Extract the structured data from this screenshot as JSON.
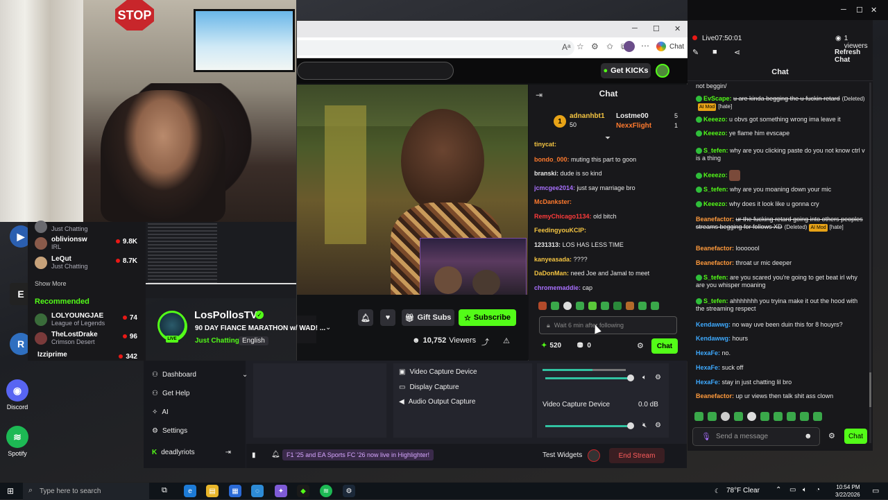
{
  "webcam": {
    "stop_sign": "STOP"
  },
  "desktop_icons": [
    {
      "label": "Discord"
    },
    {
      "label": "Spotify"
    }
  ],
  "browser": {
    "window_controls": [
      "─",
      "☐",
      "✕"
    ],
    "toolbar_chat_label": "Chat",
    "get_kicks_label": "Get KICKs",
    "chat_header": "Chat",
    "leaderboard": {
      "rank": "1",
      "first_name": "adnanhbt1",
      "first_value": "50",
      "entries": [
        {
          "name": "Lostme00",
          "value": "5"
        },
        {
          "name": "NexxFlight",
          "value": "1"
        }
      ]
    },
    "messages": [
      {
        "user": "tinycat:",
        "text": "",
        "color": "#f5c542"
      },
      {
        "user": "bondo_000:",
        "text": "muting this part to goon",
        "color": "#ff7a2e"
      },
      {
        "user": "branski:",
        "text": "dude is so kind",
        "color": "#e8e8e8"
      },
      {
        "user": "jcmcgee2014:",
        "text": "just say marriage bro",
        "color": "#a970ff"
      },
      {
        "user": "McDankster:",
        "text": "",
        "color": "#ff7a2e"
      },
      {
        "user": "RemyChicago1134:",
        "text": "old bitch",
        "color": "#ff3b3b"
      },
      {
        "user": "FeedingyouKCIP:",
        "text": "",
        "color": "#f5c542"
      },
      {
        "user": "1231313:",
        "text": "LOS HAS LESS TIME",
        "color": "#e8e8e8"
      },
      {
        "user": "kanyeasada:",
        "text": "????",
        "color": "#f5c542"
      },
      {
        "user": "DaDonMan:",
        "text": "need Joe and Jamal to meet",
        "color": "#f5c542"
      },
      {
        "user": "chromemaddie:",
        "text": "cap",
        "color": "#a970ff"
      }
    ],
    "chat_input_placeholder": "Wait 6 min after following",
    "points": "520",
    "points2": "0",
    "chat_button": "Chat",
    "sidebar": [
      {
        "name": "",
        "sub": "Just Chatting",
        "count": ""
      },
      {
        "name": "oblivionsw",
        "sub": "IRL",
        "count": "9.8K"
      },
      {
        "name": "LeQut",
        "sub": "Just Chatting",
        "count": "8.7K"
      }
    ],
    "show_more": "Show More",
    "recommended_label": "Recommended",
    "recommended": [
      {
        "name": "LOLYOUNGJAE",
        "sub": "League of Legends",
        "count": "74"
      },
      {
        "name": "TheLostDrake",
        "sub": "Crimson Desert",
        "count": "96"
      },
      {
        "name": "Izziprime",
        "sub": "",
        "count": "342"
      }
    ],
    "stream": {
      "channel": "LosPollosTV",
      "title": "90 DAY FIANCE MARATHON w/ WAD! ...",
      "category": "Just Chatting",
      "language": "English",
      "gift_subs": "Gift Subs",
      "subscribe": "Subscribe",
      "viewers": "10,752",
      "viewers_label": "Viewers",
      "live_badge": "LIVE"
    }
  },
  "obs": {
    "menu": [
      {
        "label": "Dashboard"
      },
      {
        "label": "Get Help"
      },
      {
        "label": "AI"
      },
      {
        "label": "Settings"
      }
    ],
    "user": "deadlyriots",
    "sources": [
      "Video Capture Device",
      "Display Capture",
      "Audio Output Capture"
    ],
    "mixer_label": "Video Capture Device",
    "mixer_db": "0.0 dB",
    "banner": "F1 '25 and EA Sports FC '26 now live in Highlighter!",
    "test_widgets": "Test Widgets",
    "end_stream": "End Stream"
  },
  "right_chat": {
    "live_time": "Live07:50:01",
    "viewers": "1 viewers",
    "refresh": "Refresh Chat",
    "header": "Chat",
    "messages": [
      {
        "user": "",
        "text": "not beggin/",
        "cls": "",
        "strike": false,
        "mod": false
      },
      {
        "user": "EvScape:",
        "text": "u are kinda begging the u fuckin retard",
        "cls": "name-g",
        "strike": true,
        "mod": true,
        "suffix": "[hate]"
      },
      {
        "user": "Keeezo:",
        "text": "u obvs got something wrong ima leave it",
        "cls": "name-g",
        "strike": false,
        "mod": false
      },
      {
        "user": "Keeezo:",
        "text": "ye flame him evscape",
        "cls": "name-g",
        "strike": false,
        "mod": false
      },
      {
        "user": "S_tefen:",
        "text": "why are you clicking paste do you not know ctrl v is a thing",
        "cls": "name-g",
        "strike": false,
        "mod": false
      },
      {
        "user": "Keeezo:",
        "text": "",
        "cls": "name-g",
        "strike": false,
        "mod": false
      },
      {
        "user": "S_tefen:",
        "text": "why are you moaning down your mic",
        "cls": "name-g",
        "strike": false,
        "mod": false
      },
      {
        "user": "Keeezo:",
        "text": "why does it look like u gonna cry",
        "cls": "name-g",
        "strike": false,
        "mod": false
      },
      {
        "user": "Beanefactor:",
        "text": "ur the fucking retard going into others peoples streams begging for follows XD",
        "cls": "name-o",
        "strike": true,
        "mod": true,
        "suffix": "[hate]"
      },
      {
        "user": "Beanefactor:",
        "text": "looooool",
        "cls": "name-o",
        "strike": false,
        "mod": false
      },
      {
        "user": "Beanefactor:",
        "text": "throat ur mic deeper",
        "cls": "name-o",
        "strike": false,
        "mod": false
      },
      {
        "user": "S_tefen:",
        "text": "are you scared you're going to get beat irl why are you whisper moaning",
        "cls": "name-g",
        "strike": false,
        "mod": false
      },
      {
        "user": "S_tefen:",
        "text": "ahhhhhhh you tryina make it out the hood with the streaming respect",
        "cls": "name-g",
        "strike": false,
        "mod": false
      },
      {
        "user": "Kendawwg:",
        "text": "no way uve been duin this for 8 houyrs?",
        "cls": "name-b",
        "strike": false,
        "mod": false
      },
      {
        "user": "Kendawwg:",
        "text": "hours",
        "cls": "name-b",
        "strike": false,
        "mod": false
      },
      {
        "user": "HexaFe:",
        "text": "no.",
        "cls": "name-b",
        "strike": false,
        "mod": false
      },
      {
        "user": "HexaFe:",
        "text": "suck off",
        "cls": "name-b",
        "strike": false,
        "mod": false
      },
      {
        "user": "HexaFe:",
        "text": "stay in just chatting lil bro",
        "cls": "name-b",
        "strike": false,
        "mod": false
      },
      {
        "user": "Beanefactor:",
        "text": "up ur views then talk shit ass clown",
        "cls": "name-o",
        "strike": false,
        "mod": false
      }
    ],
    "ai_mod_label": "AI Mod",
    "deleted_label": "(Deleted)",
    "input_placeholder": "Send a message",
    "chat_button": "Chat"
  },
  "taskbar": {
    "search_placeholder": "Type here to search",
    "weather": "78°F  Clear",
    "time": "10:54 PM",
    "date": "3/22/2026"
  }
}
